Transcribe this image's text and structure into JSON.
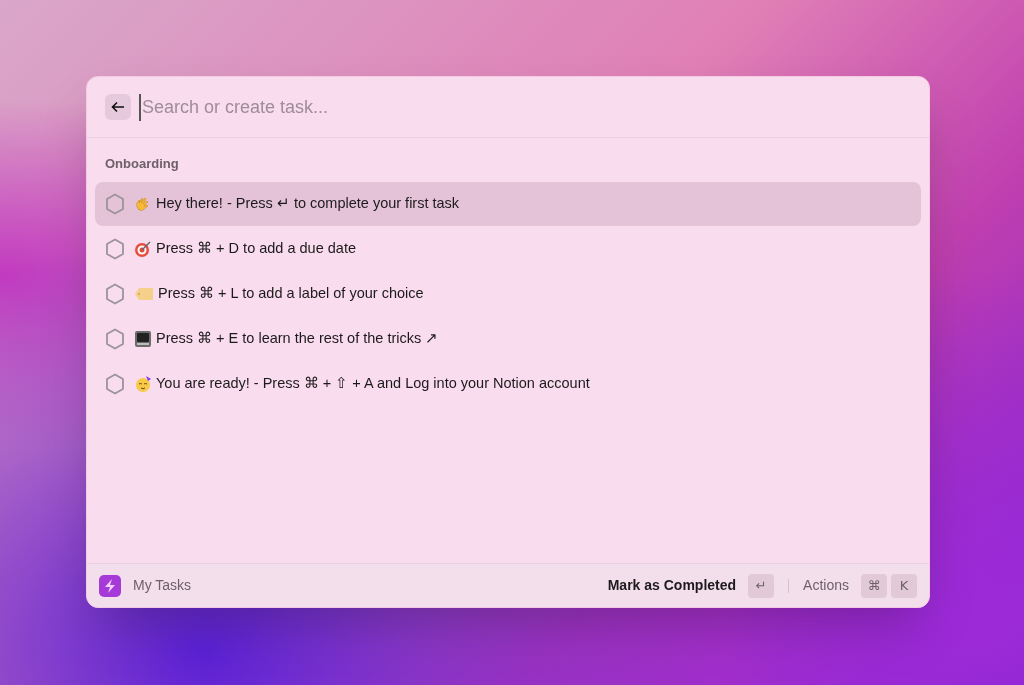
{
  "search": {
    "placeholder": "Search or create task..."
  },
  "section": "Onboarding",
  "tasks": [
    {
      "text": "Hey there! - Press ↵ to complete your first task",
      "checked": false,
      "selected": true
    },
    {
      "text": "Press ⌘ + D to add a due date",
      "checked": false,
      "selected": false
    },
    {
      "text": "Press ⌘ + L to add a label of your choice",
      "checked": false,
      "selected": false
    },
    {
      "text": "Press ⌘ + E to learn the rest of the tricks ↗",
      "checked": false,
      "selected": false
    },
    {
      "text": "You are ready! - Press ⌘ + ⇧ + A and Log into your Notion account",
      "checked": false,
      "selected": false
    }
  ],
  "footer": {
    "title": "My Tasks",
    "primary_action": "Mark as Completed",
    "primary_keys": [
      "↵"
    ],
    "secondary_action": "Actions",
    "secondary_keys": [
      "⌘",
      "K"
    ]
  }
}
